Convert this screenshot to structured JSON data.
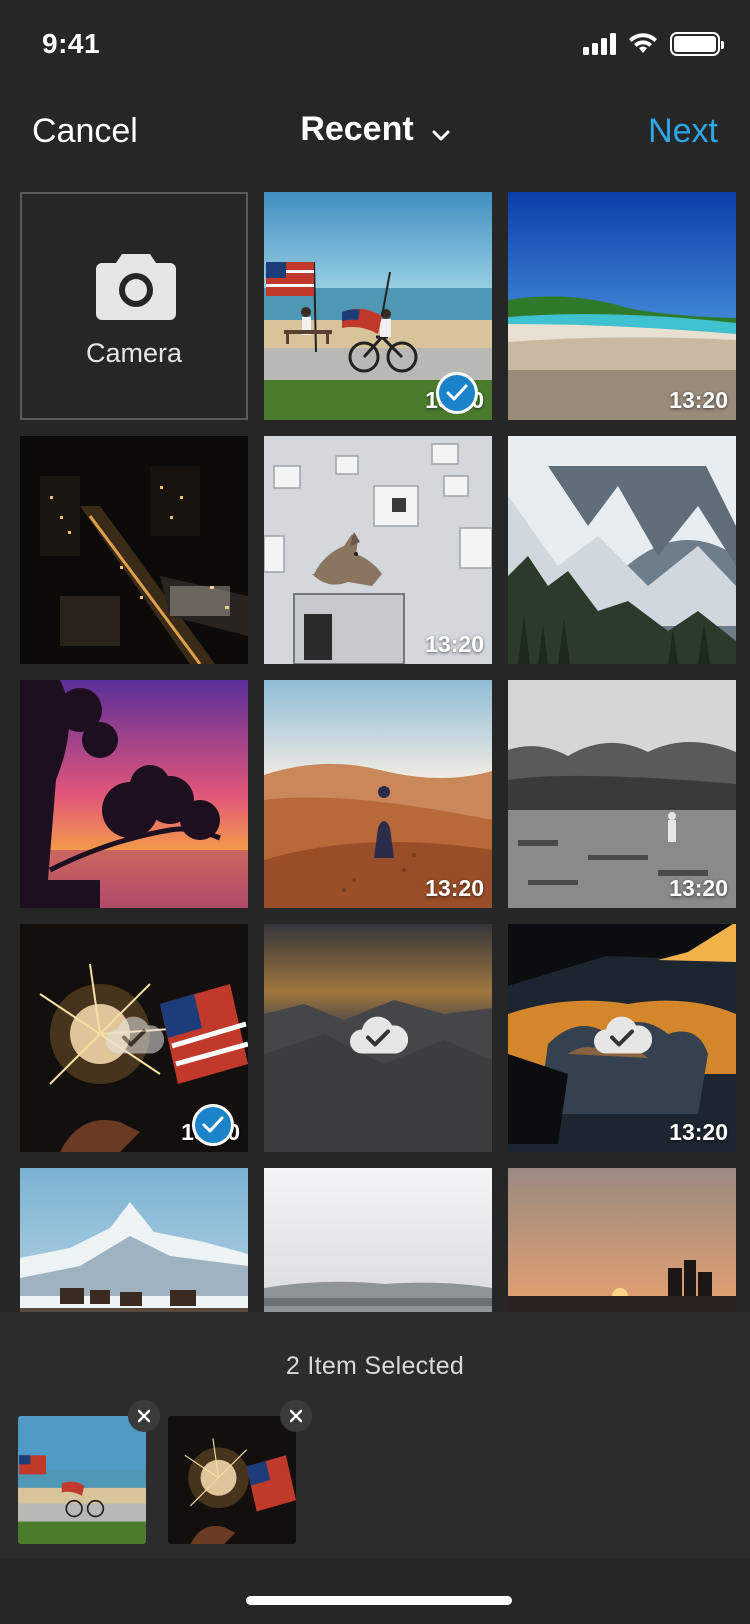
{
  "status_bar": {
    "time": "9:41"
  },
  "nav": {
    "cancel_label": "Cancel",
    "title": "Recent",
    "next_label": "Next"
  },
  "camera_tile": {
    "label": "Camera",
    "icon": "camera-icon"
  },
  "photos": [
    {
      "time": "13:20",
      "selected": true
    },
    {
      "time": "13:20",
      "selected": false
    },
    {
      "time": "",
      "selected": false
    },
    {
      "time": "13:20",
      "selected": false
    },
    {
      "time": "",
      "selected": false
    },
    {
      "time": "",
      "selected": false
    },
    {
      "time": "13:20",
      "selected": false
    },
    {
      "time": "13:20",
      "selected": false
    },
    {
      "time": "13:20",
      "selected": true,
      "icloud": true
    },
    {
      "time": "",
      "selected": false,
      "icloud": true
    },
    {
      "time": "13:20",
      "selected": false,
      "icloud": true
    },
    {
      "time": "",
      "selected": false
    },
    {
      "time": "",
      "selected": false
    },
    {
      "time": "",
      "selected": false
    }
  ],
  "selection": {
    "count_label": "2 Item Selected"
  },
  "colors": {
    "accent": "#2ea7e8",
    "check": "#1b83c9",
    "background": "#262626",
    "panel": "#2c2c2c"
  }
}
